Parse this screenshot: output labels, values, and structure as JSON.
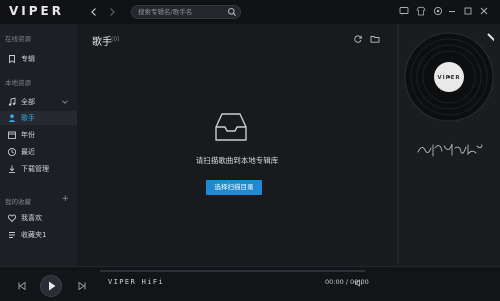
{
  "app": {
    "logo": "VIPER"
  },
  "search": {
    "placeholder": "搜索专辑名/歌手名"
  },
  "sidebar": {
    "online_title": "在线资源",
    "online_items": [
      {
        "label": "专辑",
        "icon": "bookmark-icon"
      }
    ],
    "local_title": "本地资源",
    "local_items": [
      {
        "label": "全部",
        "icon": "music-note-icon"
      },
      {
        "label": "歌手",
        "icon": "person-icon"
      },
      {
        "label": "年份",
        "icon": "calendar-icon"
      },
      {
        "label": "最近",
        "icon": "clock-icon"
      },
      {
        "label": "下载管理",
        "icon": "download-icon"
      }
    ],
    "collection_title": "我的收藏",
    "collection_plus": "+",
    "collection_items": [
      {
        "label": "我喜欢",
        "icon": "heart-icon"
      },
      {
        "label": "收藏夹1",
        "icon": "list-icon"
      }
    ]
  },
  "main": {
    "title": "歌手",
    "count": "(0)",
    "empty_message": "请扫描歌曲到本地专辑库",
    "scan_button": "选择扫描目录"
  },
  "player": {
    "track_title": "VIPER HiFi",
    "time": "00:00 / 00:00"
  },
  "colors": {
    "accent": "#1f8ad3",
    "active_text": "#34a7e8",
    "background": "#17191d"
  }
}
